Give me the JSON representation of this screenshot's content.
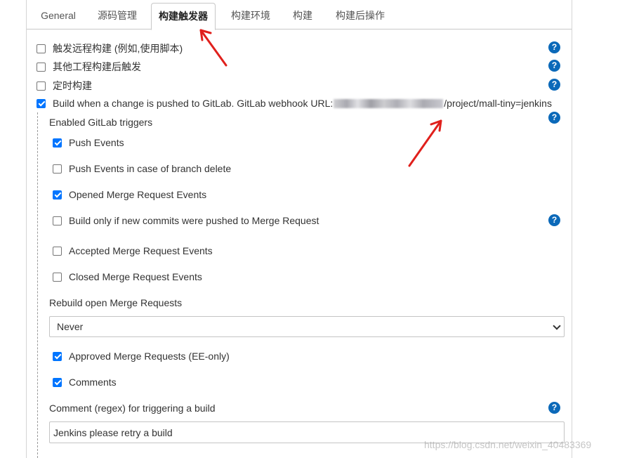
{
  "tabs": [
    {
      "label": "General",
      "active": false
    },
    {
      "label": "源码管理",
      "active": false
    },
    {
      "label": "构建触发器",
      "active": true
    },
    {
      "label": "构建环境",
      "active": false
    },
    {
      "label": "构建",
      "active": false
    },
    {
      "label": "构建后操作",
      "active": false
    }
  ],
  "triggers": {
    "remote": {
      "label": "触发远程构建 (例如,使用脚本)",
      "checked": false
    },
    "after_other": {
      "label": "其他工程构建后触发",
      "checked": false
    },
    "periodic": {
      "label": "定时构建",
      "checked": false
    },
    "gitlab": {
      "label_prefix": "Build when a change is pushed to GitLab. GitLab webhook URL:",
      "label_suffix": "/project/mall-tiny=jenkins",
      "checked": true
    }
  },
  "gitlab": {
    "enabled_triggers_label": "Enabled GitLab triggers",
    "options": [
      {
        "label": "Push Events",
        "checked": true
      },
      {
        "label": "Push Events in case of branch delete",
        "checked": false
      },
      {
        "label": "Opened Merge Request Events",
        "checked": true
      },
      {
        "label": "Build only if new commits were pushed to Merge Request",
        "checked": false
      },
      {
        "label": "Accepted Merge Request Events",
        "checked": false
      },
      {
        "label": "Closed Merge Request Events",
        "checked": false
      }
    ],
    "rebuild_label": "Rebuild open Merge Requests",
    "rebuild_selected": "Never",
    "approved": {
      "label": "Approved Merge Requests (EE-only)",
      "checked": true
    },
    "comments": {
      "label": "Comments",
      "checked": true
    },
    "comment_regex_label": "Comment (regex) for triggering a build",
    "comment_regex_value": "Jenkins please retry a build"
  },
  "help_glyph": "?",
  "watermark": "https://blog.csdn.net/weixin_40483369",
  "colors": {
    "checkbox_checked": "#0075ff",
    "help_icon": "#0b69b9",
    "annotation_arrow": "#e0201c"
  },
  "icons": {
    "help": "question-circle-icon",
    "select": "chevron-down-icon",
    "annotation": "red-arrow-icon"
  }
}
